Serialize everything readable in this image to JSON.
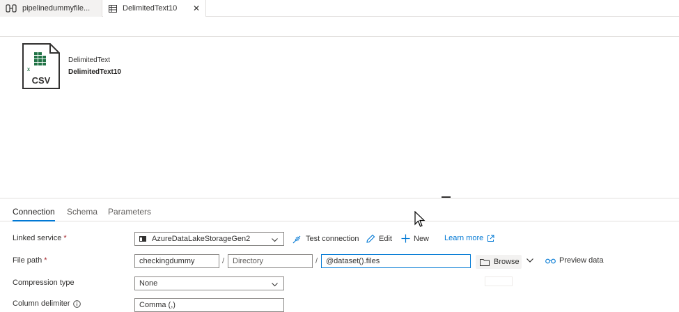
{
  "tabs": [
    {
      "label": "pipelinedummyfile...",
      "icon": "pipeline-icon",
      "active": false
    },
    {
      "label": "DelimitedText10",
      "icon": "table-icon",
      "active": true,
      "close": "✕"
    }
  ],
  "dataset": {
    "icon_text": "CSV",
    "type": "DelimitedText",
    "name": "DelimitedText10"
  },
  "panel": {
    "tabs": [
      "Connection",
      "Schema",
      "Parameters"
    ],
    "active_tab": "Connection"
  },
  "form": {
    "linked_service": {
      "label": "Linked service",
      "required": "*",
      "value": "AzureDataLakeStorageGen2",
      "actions": {
        "test_connection": "Test connection",
        "edit": "Edit",
        "new": "New",
        "learn_more": "Learn more"
      }
    },
    "file_path": {
      "label": "File path",
      "required": "*",
      "container": "checkingdummy",
      "directory_placeholder": "Directory",
      "file": "@dataset().files",
      "separator": "/",
      "browse": "Browse",
      "preview": "Preview data"
    },
    "compression": {
      "label": "Compression type",
      "value": "None"
    },
    "column_delimiter": {
      "label": "Column delimiter",
      "value": "Comma (,)"
    }
  },
  "colors": {
    "accent": "#0078d4",
    "required": "#a4262c",
    "excel_green": "#217346"
  }
}
